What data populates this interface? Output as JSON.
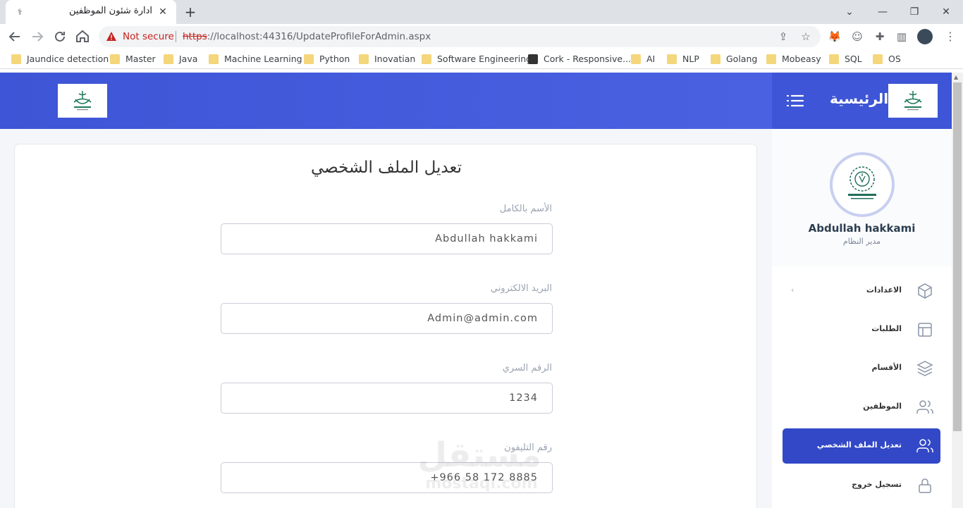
{
  "browser": {
    "tab_title": "ادارة شئون الموظفين",
    "tab_favicon": "syringe-icon",
    "not_secure": "Not secure",
    "url_scheme": "https",
    "url_rest": "://localhost:44316/UpdateProfileForAdmin.aspx",
    "bookmarks": [
      "Jaundice detection",
      "Master",
      "Java",
      "Machine Learning",
      "Python",
      "Inovatian",
      "Software Engineering",
      "Cork - Responsive...",
      "AI",
      "NLP",
      "Golang",
      "Mobeasy",
      "SQL",
      "OS"
    ]
  },
  "sidebar": {
    "home": "الرئيسية",
    "user_name": "Abdullah hakkami",
    "user_role": "مدير النظام",
    "items": [
      {
        "label": "الاعدادات",
        "icon": "box-icon",
        "has_chevron": true
      },
      {
        "label": "الطلبات",
        "icon": "layout-icon"
      },
      {
        "label": "الأقسام",
        "icon": "layers-icon"
      },
      {
        "label": "الموظفين",
        "icon": "users-icon"
      },
      {
        "label": "تعديل الملف الشخصي",
        "icon": "users-icon",
        "active": true
      },
      {
        "label": "تسجيل خروج",
        "icon": "lock-icon"
      }
    ]
  },
  "form": {
    "title": "تعديل الملف الشخصي",
    "fullname_label": "الأسم بالكامل",
    "fullname_value": "Abdullah hakkami",
    "email_label": "البريد الالكتروني",
    "email_value": "Admin@admin.com",
    "password_label": "الرقم السري",
    "password_value": "1234",
    "phone_label": "رقم التليفون",
    "phone_value": "+966 58 172 8885"
  },
  "watermark": {
    "ar": "مستقل",
    "en": "mostaql.com"
  },
  "colors": {
    "accent": "#3d55d6",
    "active_menu": "#3348c6"
  }
}
